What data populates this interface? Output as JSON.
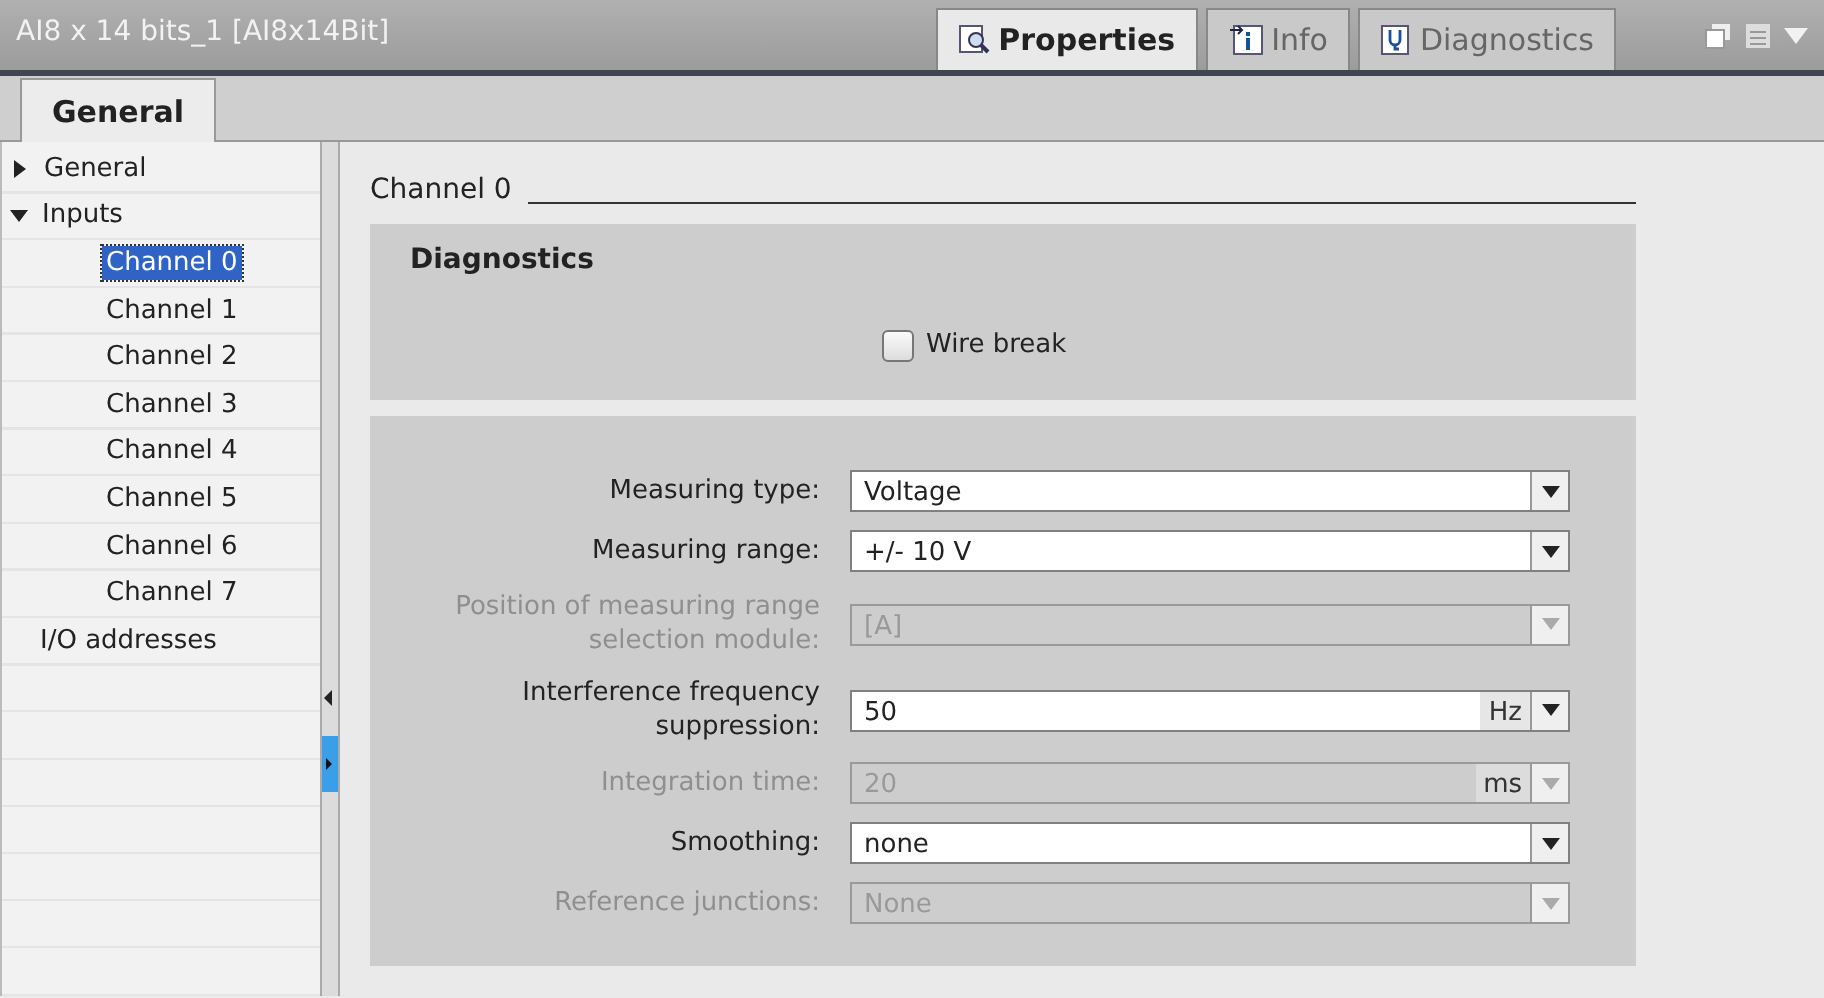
{
  "window": {
    "title": "AI8 x 14 bits_1 [AI8x14Bit]"
  },
  "tabs": [
    {
      "label": "Properties",
      "selected": true,
      "kind": "properties"
    },
    {
      "label": "Info",
      "selected": false,
      "kind": "info"
    },
    {
      "label": "Diagnostics",
      "selected": false,
      "kind": "diagnostics"
    }
  ],
  "sub_tabs": [
    {
      "label": "General",
      "selected": true
    }
  ],
  "tree": [
    {
      "label": "General",
      "expanded": false,
      "selected": false
    },
    {
      "label": "Inputs",
      "expanded": true,
      "selected": false,
      "children": [
        {
          "label": "Channel 0",
          "selected": true
        },
        {
          "label": "Channel 1",
          "selected": false
        },
        {
          "label": "Channel 2",
          "selected": false
        },
        {
          "label": "Channel 3",
          "selected": false
        },
        {
          "label": "Channel 4",
          "selected": false
        },
        {
          "label": "Channel 5",
          "selected": false
        },
        {
          "label": "Channel 6",
          "selected": false
        },
        {
          "label": "Channel 7",
          "selected": false
        }
      ]
    },
    {
      "label": "I/O addresses",
      "selected": false
    }
  ],
  "section_title": "Channel 0",
  "diagnostics": {
    "title": "Diagnostics",
    "checkbox": {
      "label": "Wire break",
      "checked": false
    }
  },
  "params": [
    {
      "label": "Measuring type:",
      "value": "Voltage",
      "disabled": false
    },
    {
      "label": "Measuring range:",
      "value": "+/- 10 V",
      "disabled": false
    },
    {
      "label": "Position of measuring range selection module:",
      "value": "[A]",
      "disabled": true
    },
    {
      "label": "Interference frequency suppression:",
      "value": "50",
      "unit": "Hz",
      "disabled": false
    },
    {
      "label": "Integration time:",
      "value": "20",
      "unit": "ms",
      "disabled": true
    },
    {
      "label": "Smoothing:",
      "value": "none",
      "disabled": false
    },
    {
      "label": "Reference junctions:",
      "value": "None",
      "disabled": true
    }
  ]
}
